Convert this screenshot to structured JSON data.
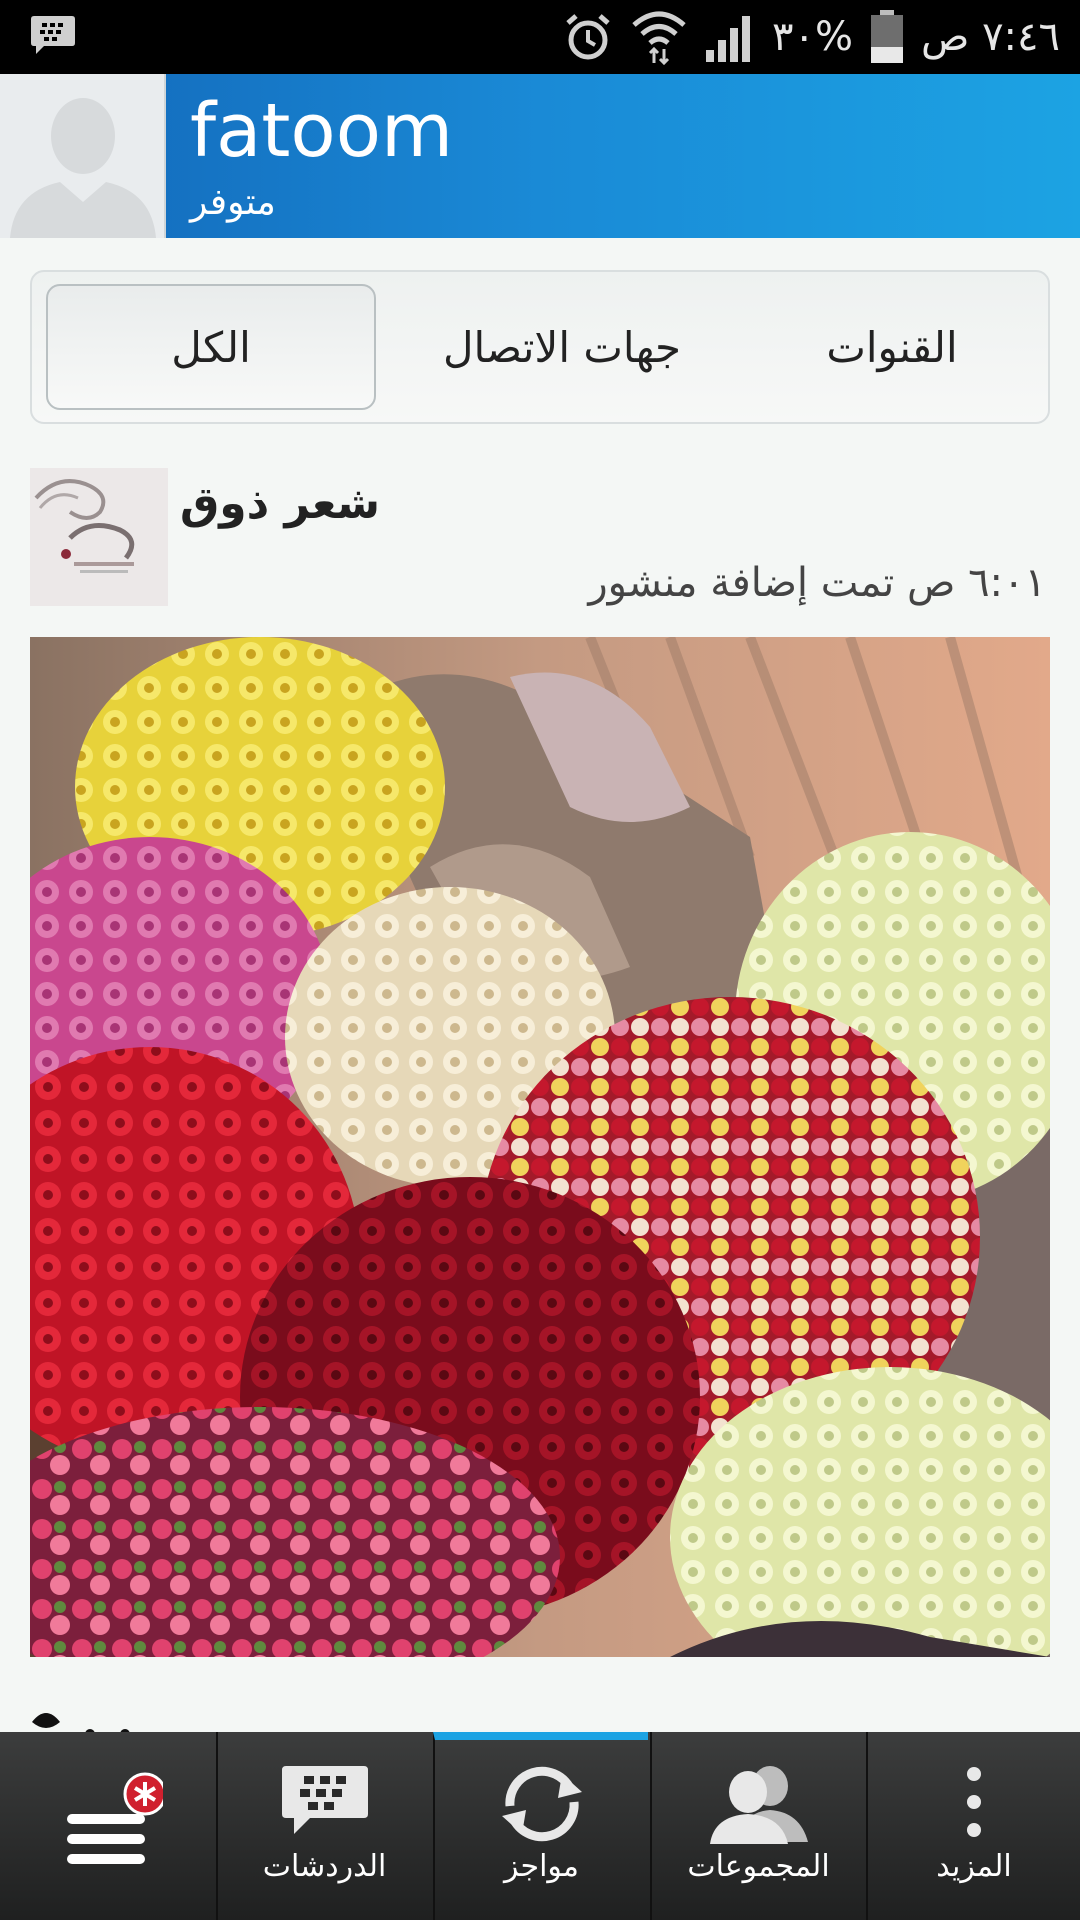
{
  "status_bar": {
    "time": "٧:٤٦ ص",
    "battery": "٣٠%"
  },
  "header": {
    "name": "fatoom",
    "status": "متوفر"
  },
  "tabs": [
    {
      "label": "الكل",
      "selected": true
    },
    {
      "label": "جهات الاتصال",
      "selected": false
    },
    {
      "label": "القنوات",
      "selected": false
    }
  ],
  "post": {
    "title": "شعر ذوق",
    "subtitle": "٦:٠١ ص تمت إضافة منشور"
  },
  "bottom_bar": {
    "items": [
      {
        "label": "",
        "icon": "menu-icon"
      },
      {
        "label": "الدردشات",
        "icon": "bbm-chat-icon"
      },
      {
        "label": "مواجز",
        "icon": "refresh-icon"
      },
      {
        "label": "المجموعات",
        "icon": "groups-icon"
      },
      {
        "label": "المزيد",
        "icon": "more-vertical-icon"
      }
    ]
  },
  "colors": {
    "accent": "#1ca3e3",
    "header_start": "#1266b8"
  }
}
